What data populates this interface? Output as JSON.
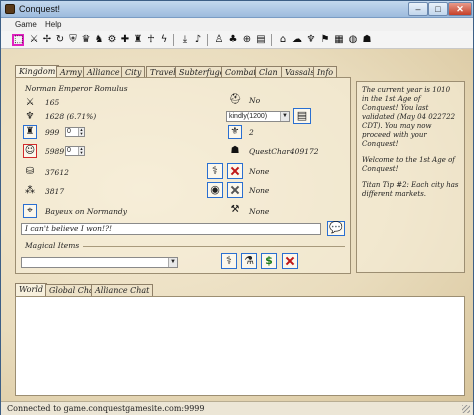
{
  "window": {
    "title": "Conquest!"
  },
  "menu": {
    "game": "Game",
    "help": "Help"
  },
  "tabs": [
    "Kingdom",
    "Army",
    "Alliance",
    "City",
    "Travel",
    "Subterfuge",
    "Combat",
    "Clan",
    "Vassals",
    "Info"
  ],
  "kingdom": {
    "ruler": "Norman Emperor Romulus",
    "level": "165",
    "land": "1628 (6.71%)",
    "buildings": "999",
    "buildings_spin": "0",
    "gold": "5989",
    "gold_spin": "0",
    "stone": "37612",
    "food": "3817",
    "capital": "Bayeux on Normandy",
    "war_status": "No",
    "attitude_select": "kindly(1200)",
    "clan_count": "2",
    "ally": "QuestChar409172",
    "none_1": "None",
    "none_2": "None",
    "none_3": "None",
    "message": "I can't believe I won!?!",
    "magical_items_label": "Magical Items",
    "magical_items_select": ""
  },
  "news": [
    "The current year is 1010 in the 1st Age of Conquest! You last validated (May 04 022722 CDT). You may now proceed with your Conquest!",
    "Welcome to the 1st Age of Conquest!",
    "Titan Tip #2: Each city has different markets."
  ],
  "chat_tabs": [
    "World",
    "Global Chat",
    "Alliance Chat"
  ],
  "status": "Connected to game.conquestgamesite.com:9999",
  "icons": {
    "toolbar": [
      "select-icon",
      "sword-icon",
      "compass-icon",
      "refresh-icon",
      "shield-icon",
      "crown-icon",
      "horse-icon",
      "gears-icon",
      "cross-icon",
      "castle-icon",
      "monk-icon",
      "lightning-icon",
      "down-arrow-icon",
      "music-icon",
      "figure-icon",
      "tree-icon",
      "target-icon",
      "book-icon",
      "dome-icon",
      "cloud-icon",
      "palm-icon",
      "flag-icon",
      "chess-icon",
      "globe-icon",
      "wizard-icon"
    ]
  }
}
